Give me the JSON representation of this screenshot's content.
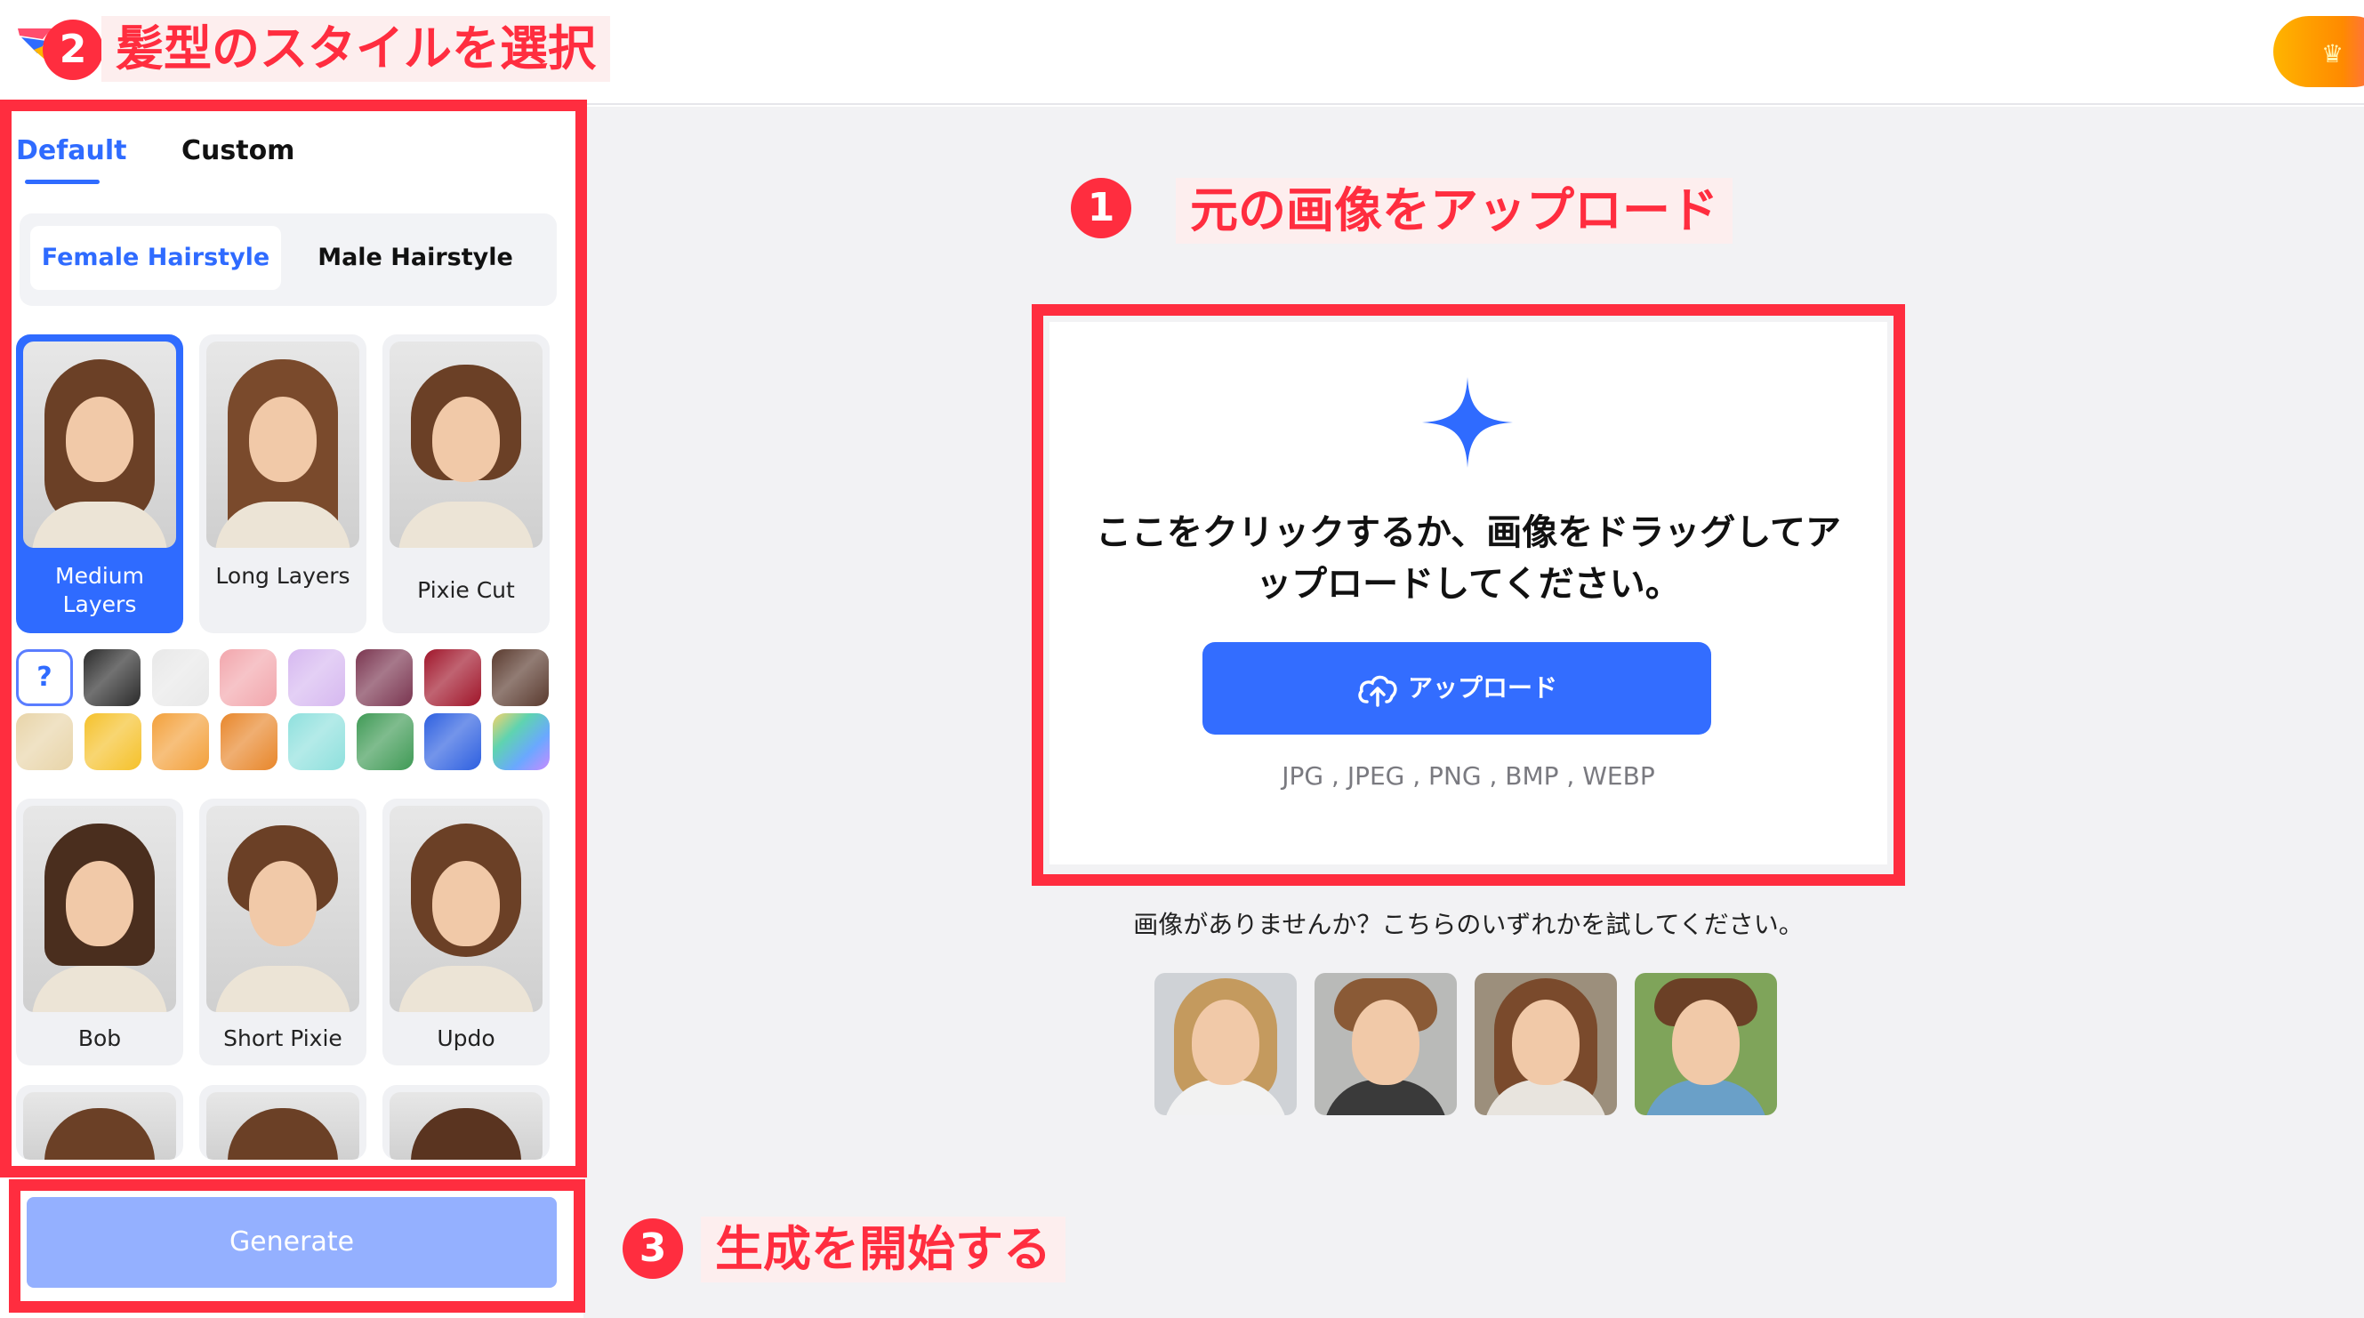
{
  "annotations": {
    "step1": {
      "number": "1",
      "text": "元の画像をアップロード"
    },
    "step2": {
      "number": "2",
      "text": "髪型のスタイルを選択"
    },
    "step3": {
      "number": "3",
      "text": "生成を開始する"
    },
    "accent_color": "#ff2d3f"
  },
  "sidebar": {
    "tabs": [
      {
        "label": "Default",
        "active": true
      },
      {
        "label": "Custom",
        "active": false
      }
    ],
    "gender": [
      {
        "label": "Female Hairstyle",
        "active": true
      },
      {
        "label": "Male Hairstyle",
        "active": false
      }
    ],
    "styles_row1": [
      {
        "label": "Medium Layers",
        "selected": true
      },
      {
        "label": "Long Layers",
        "selected": false
      },
      {
        "label": "Pixie Cut",
        "selected": false
      }
    ],
    "styles_row2": [
      {
        "label": "Bob"
      },
      {
        "label": "Short Pixie"
      },
      {
        "label": "Updo"
      }
    ],
    "color_unknown_label": "?",
    "colors_row1": [
      "#2b2b2b",
      "#e8e8e8",
      "#f2a6ac",
      "#d6b8f0",
      "#7a3550",
      "#a0152a",
      "#5a3a2e"
    ],
    "colors_row2": [
      "#e8d4a8",
      "#f5c12a",
      "#f3a03a",
      "#e8862a",
      "#8ee0dd",
      "#3f9a55",
      "#2d5fe0",
      "rainbow"
    ],
    "generate_label": "Generate"
  },
  "upload": {
    "instruction": "ここをクリックするか、画像をドラッグしてアップロードしてください。",
    "button_label": "アップロード",
    "formats": "JPG , JPEG , PNG , BMP , WEBP",
    "sample_prompt": "画像がありませんか？こちらのいずれかを試してください。"
  },
  "brand_color": "#2f6bff"
}
